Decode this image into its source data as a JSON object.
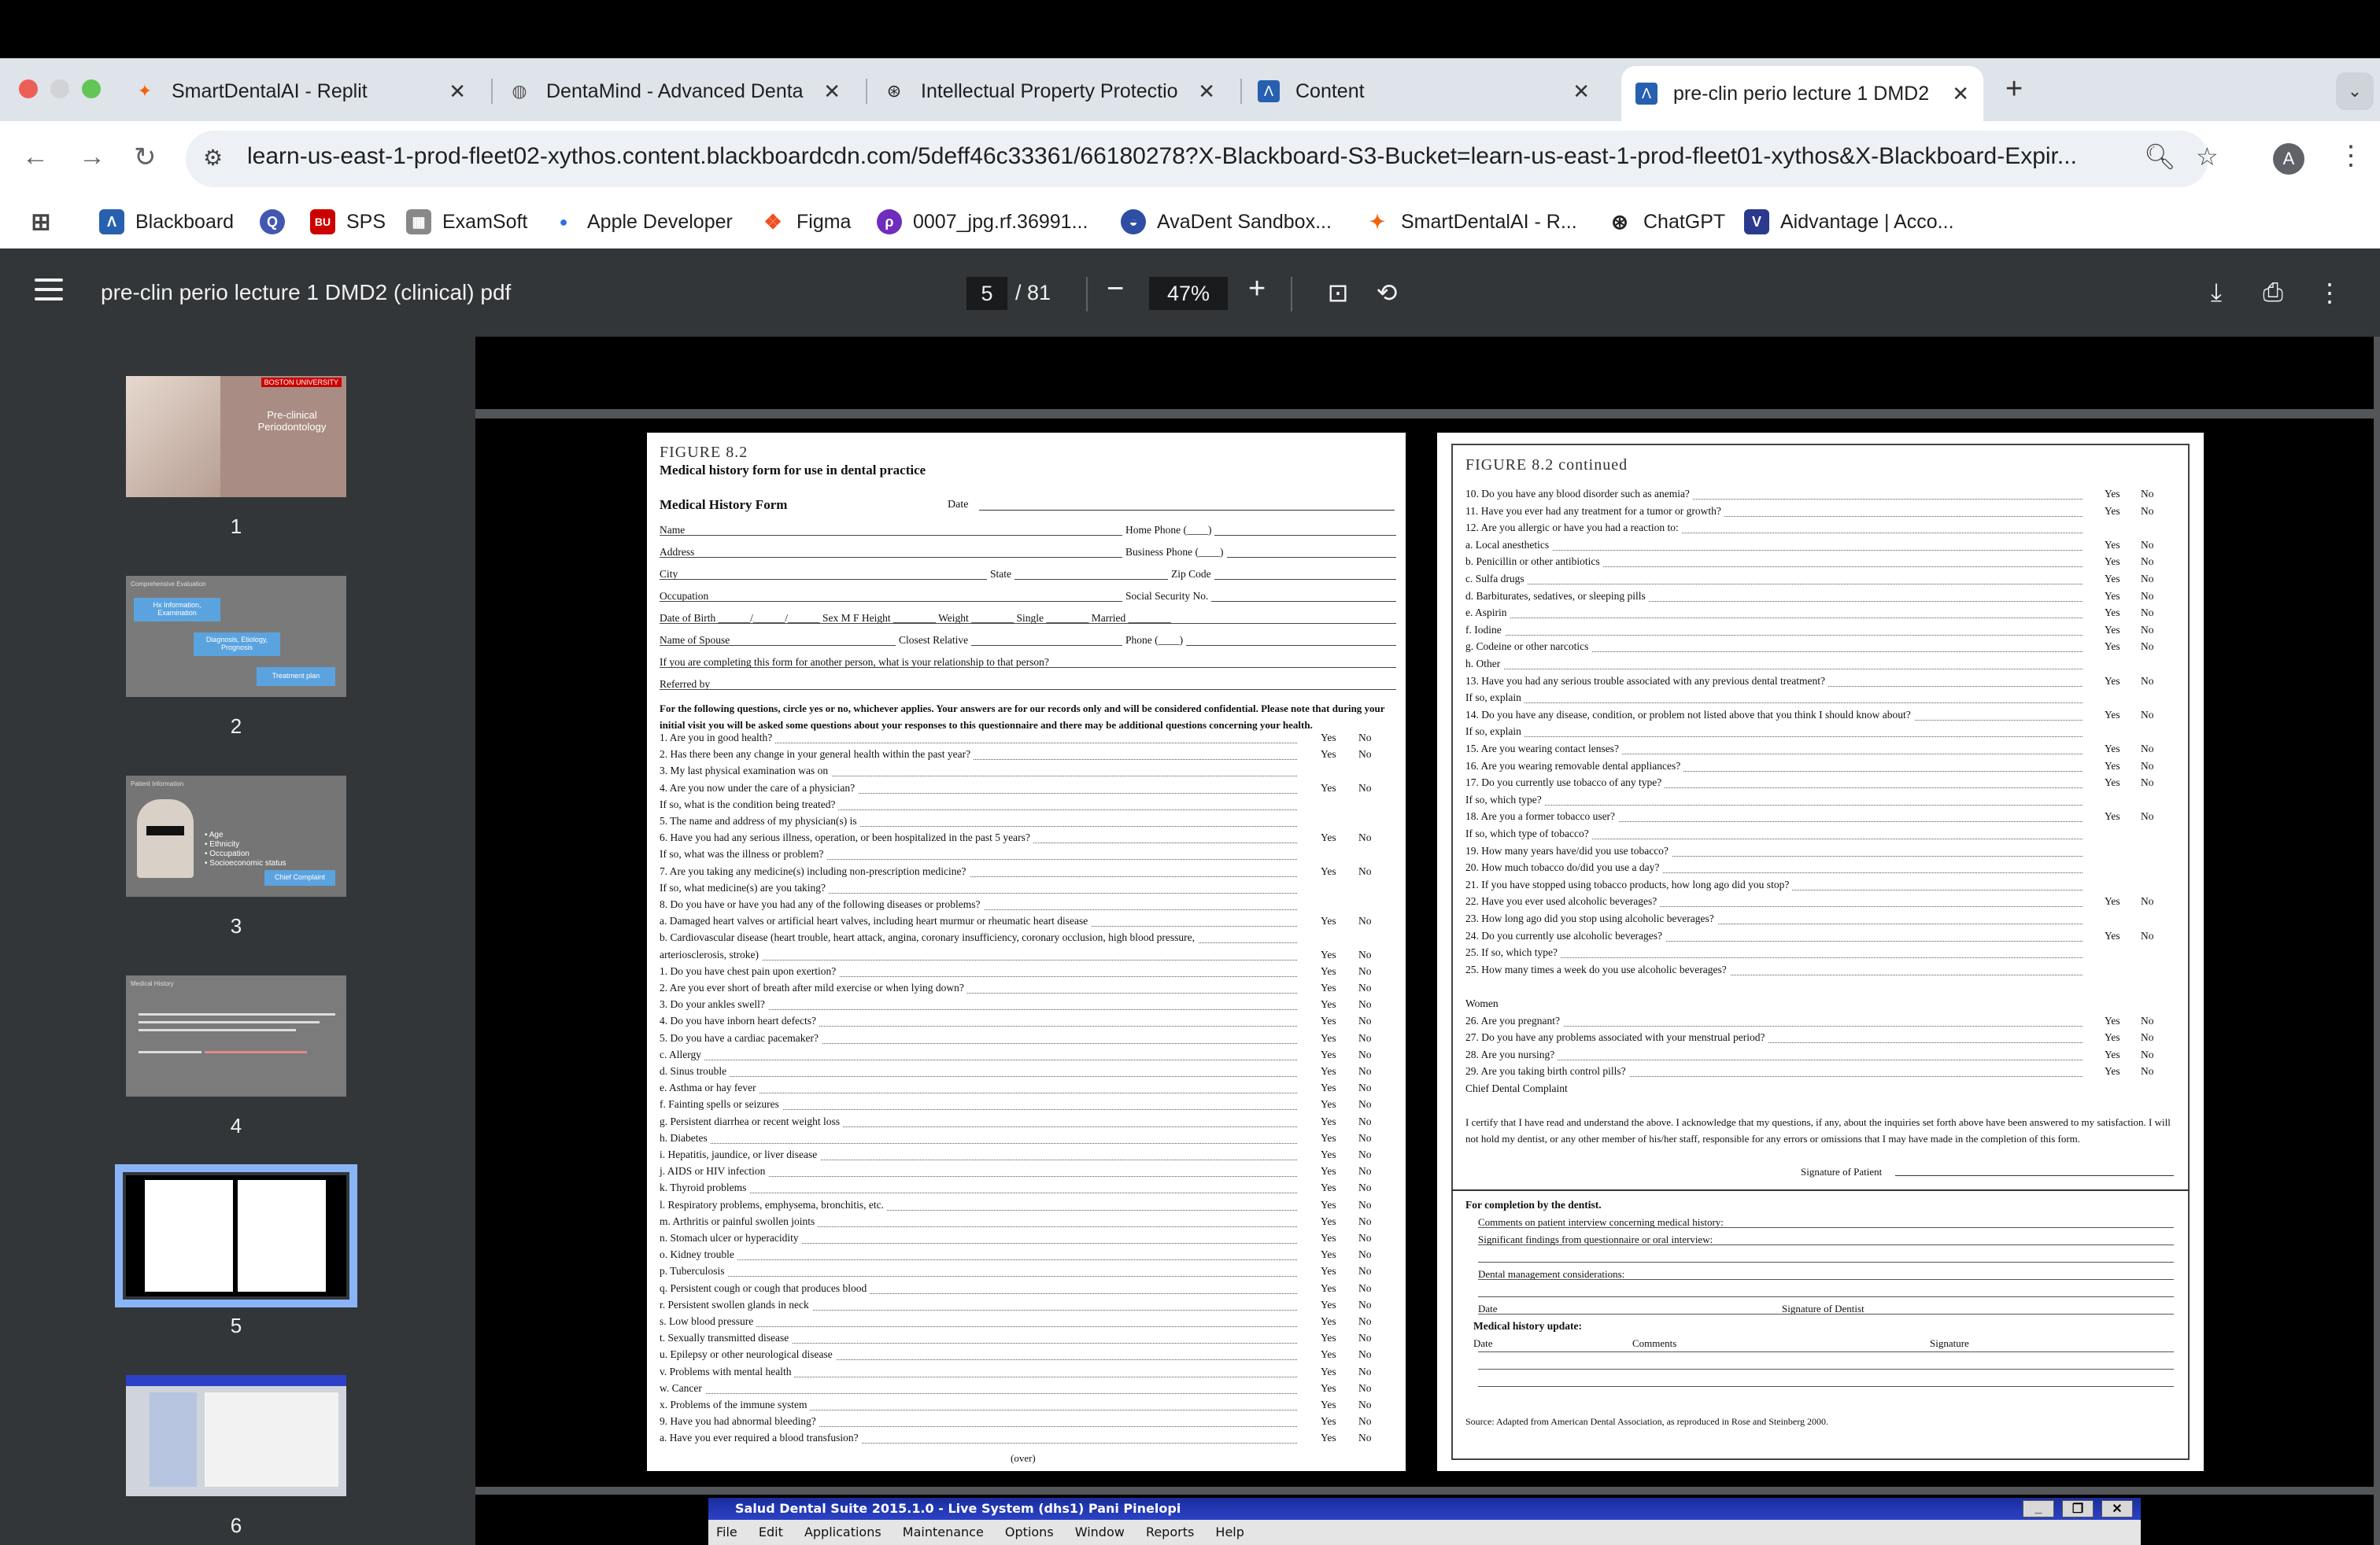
{
  "tabs": [
    {
      "label": "SmartDentalAI - Replit",
      "icon": "replit-icon"
    },
    {
      "label": "DentaMind - Advanced Denta",
      "icon": "globe-icon"
    },
    {
      "label": "Intellectual Property Protectio",
      "icon": "openai-icon"
    },
    {
      "label": "Content",
      "icon": "blackboard-icon"
    },
    {
      "label": "pre-clin perio lecture 1 DMD2",
      "icon": "blackboard-icon",
      "active": true
    }
  ],
  "address_bar": {
    "url": "learn-us-east-1-prod-fleet02-xythos.content.blackboardcdn.com/5deff46c33361/66180278?X-Blackboard-S3-Bucket=learn-us-east-1-prod-fleet01-xythos&X-Blackboard-Expir...",
    "profile_initial": "A"
  },
  "bookmarks": [
    {
      "label": "Blackboard"
    },
    {
      "label": ""
    },
    {
      "label": "SPS"
    },
    {
      "label": "ExamSoft"
    },
    {
      "label": "Apple Developer"
    },
    {
      "label": "Figma"
    },
    {
      "label": "0007_jpg.rf.36991..."
    },
    {
      "label": "AvaDent Sandbox..."
    },
    {
      "label": "SmartDentalAI - R..."
    },
    {
      "label": "ChatGPT"
    },
    {
      "label": "Aidvantage | Acco..."
    }
  ],
  "pdf_toolbar": {
    "title": "pre-clin perio lecture 1 DMD2 (clinical) pdf",
    "current_page": "5",
    "total_pages": "/ 81",
    "zoom": "47%",
    "zoom_out": "−",
    "zoom_in": "+"
  },
  "thumbnails": [
    {
      "num": "1",
      "title": "Pre-clinical Periodontology",
      "brand": "BOSTON UNIVERSITY"
    },
    {
      "num": "2",
      "title": "Comprehensive Evaluation",
      "boxes": [
        "Hx Information, Examination",
        "Diagnosis, Etiology, Prognosis",
        "Treatment plan"
      ]
    },
    {
      "num": "3",
      "title": "Patient Information",
      "bullets": [
        "Age",
        "Ethnicity",
        "Occupation",
        "Socioeconomic status"
      ],
      "badge": "Chief Complaint"
    },
    {
      "num": "4",
      "title": "Medical History"
    },
    {
      "num": "5"
    },
    {
      "num": "6"
    }
  ],
  "form_left": {
    "figure": "FIGURE 8.2",
    "caption": "Medical history form for use in dental practice",
    "heading": "Medical History Form",
    "date_label": "Date",
    "fields": [
      {
        "label": "Name",
        "right": "Home Phone (____)"
      },
      {
        "label": "Address",
        "right": "Business Phone (____)"
      },
      {
        "label": "City",
        "mid": "State",
        "right": "Zip Code"
      },
      {
        "label": "Occupation",
        "right": "Social Security No."
      },
      {
        "label": "Date of Birth ______/______/______  Sex  M  F   Height ________  Weight ________  Single ________  Married ________"
      },
      {
        "label": "Name of Spouse",
        "mid": "Closest Relative",
        "right": "Phone (____)"
      },
      {
        "label": "If you are completing this form for another person, what is your relationship to that person?"
      },
      {
        "label": "Referred by"
      }
    ],
    "instructions": "For the following questions, circle yes or no, whichever applies. Your answers are for our records only and will be considered confidential. Please note that during your initial visit you will be asked some questions about your responses to this questionnaire and there may be additional questions concerning your health.",
    "questions": [
      {
        "t": "1.  Are you in good health?",
        "yn": true
      },
      {
        "t": "2.  Has there been any change in your general health within the past year?",
        "yn": true
      },
      {
        "t": "3.  My last physical examination was on"
      },
      {
        "t": "4.  Are you now under the care of a physician?",
        "yn": true
      },
      {
        "t": "      If so, what is the condition being treated?"
      },
      {
        "t": "5.  The name and address of my physician(s) is"
      },
      {
        "t": "6.  Have you had any serious illness, operation, or been hospitalized in the past 5 years?",
        "yn": true
      },
      {
        "t": "      If so, what was the illness or problem?"
      },
      {
        "t": "7.  Are you taking any medicine(s) including non-prescription medicine?",
        "yn": true
      },
      {
        "t": "      If so, what medicine(s) are you taking?"
      },
      {
        "t": "8.  Do you have or have you had any of the following diseases or problems?"
      },
      {
        "t": "      a.  Damaged heart valves or artificial heart valves, including heart murmur or rheumatic heart disease",
        "yn": true
      },
      {
        "t": "      b.  Cardiovascular disease (heart trouble, heart attack, angina, coronary insufficiency, coronary occlusion, high blood pressure,"
      },
      {
        "t": "           arteriosclerosis, stroke)",
        "yn": true
      },
      {
        "t": "           1.  Do you have chest pain upon exertion?",
        "yn": true
      },
      {
        "t": "           2.  Are you ever short of breath after mild exercise or when lying down?",
        "yn": true
      },
      {
        "t": "           3.  Do your ankles swell?",
        "yn": true
      },
      {
        "t": "           4.  Do you have inborn heart defects?",
        "yn": true
      },
      {
        "t": "           5.  Do you have a cardiac pacemaker?",
        "yn": true
      },
      {
        "t": "      c.  Allergy",
        "yn": true
      },
      {
        "t": "      d.  Sinus trouble",
        "yn": true
      },
      {
        "t": "      e.  Asthma or hay fever",
        "yn": true
      },
      {
        "t": "      f.  Fainting spells or seizures",
        "yn": true
      },
      {
        "t": "      g.  Persistent diarrhea or recent weight loss",
        "yn": true
      },
      {
        "t": "      h.  Diabetes",
        "yn": true
      },
      {
        "t": "      i.  Hepatitis, jaundice, or liver disease",
        "yn": true
      },
      {
        "t": "      j.  AIDS or HIV infection",
        "yn": true
      },
      {
        "t": "      k.  Thyroid problems",
        "yn": true
      },
      {
        "t": "      l.  Respiratory problems, emphysema, bronchitis, etc.",
        "yn": true
      },
      {
        "t": "      m.  Arthritis or painful swollen joints",
        "yn": true
      },
      {
        "t": "      n.  Stomach ulcer or hyperacidity",
        "yn": true
      },
      {
        "t": "      o.  Kidney trouble",
        "yn": true
      },
      {
        "t": "      p.  Tuberculosis",
        "yn": true
      },
      {
        "t": "      q.  Persistent cough or cough that produces blood",
        "yn": true
      },
      {
        "t": "      r.  Persistent swollen glands in neck",
        "yn": true
      },
      {
        "t": "      s.  Low blood pressure",
        "yn": true
      },
      {
        "t": "      t.  Sexually transmitted disease",
        "yn": true
      },
      {
        "t": "      u.  Epilepsy or other neurological disease",
        "yn": true
      },
      {
        "t": "      v.  Problems with mental health",
        "yn": true
      },
      {
        "t": "      w.  Cancer",
        "yn": true
      },
      {
        "t": "      x.  Problems of the immune system",
        "yn": true
      },
      {
        "t": "9.  Have you had abnormal bleeding?",
        "yn": true
      },
      {
        "t": "      a.  Have you ever required a blood transfusion?",
        "yn": true
      }
    ],
    "over": "(over)",
    "yes": "Yes",
    "no": "No"
  },
  "form_right": {
    "figure": "FIGURE 8.2 continued",
    "questions": [
      {
        "t": "10.  Do you have any blood disorder such as anemia?",
        "yn": true
      },
      {
        "t": "11.  Have you ever had any treatment for a tumor or growth?",
        "yn": true
      },
      {
        "t": "12.  Are you allergic or have you had a reaction to:"
      },
      {
        "t": "        a.  Local anesthetics",
        "yn": true
      },
      {
        "t": "        b.  Penicillin or other antibiotics",
        "yn": true
      },
      {
        "t": "        c.  Sulfa drugs",
        "yn": true
      },
      {
        "t": "        d.  Barbiturates, sedatives, or sleeping pills",
        "yn": true
      },
      {
        "t": "        e.  Aspirin",
        "yn": true
      },
      {
        "t": "        f.  Iodine",
        "yn": true
      },
      {
        "t": "        g.  Codeine or other narcotics",
        "yn": true
      },
      {
        "t": "        h.  Other"
      },
      {
        "t": "13.  Have you had any serious trouble associated with any previous dental treatment?",
        "yn": true
      },
      {
        "t": "        If so, explain"
      },
      {
        "t": "14.  Do you have any disease, condition, or problem not listed above that you think I should know about?",
        "yn": true
      },
      {
        "t": "        If so, explain"
      },
      {
        "t": "15.  Are you wearing contact lenses?",
        "yn": true
      },
      {
        "t": "16.  Are you wearing removable dental appliances?",
        "yn": true
      },
      {
        "t": "17.  Do you currently use tobacco of any type?",
        "yn": true
      },
      {
        "t": "        If so, which type?"
      },
      {
        "t": "18.  Are you a former tobacco user?",
        "yn": true
      },
      {
        "t": "        If so, which type of tobacco?"
      },
      {
        "t": "19.  How many years have/did you use tobacco?"
      },
      {
        "t": "20.  How much tobacco do/did you use a day?"
      },
      {
        "t": "21.  If you have stopped using tobacco products, how long ago did you stop?"
      },
      {
        "t": "22.  Have you ever used alcoholic beverages?",
        "yn": true
      },
      {
        "t": "23.  How long ago did you stop using alcoholic beverages?"
      },
      {
        "t": "24.  Do you currently use alcoholic beverages?",
        "yn": true
      },
      {
        "t": "25.  If so, which type?"
      },
      {
        "t": "25.  How many times a week do you use alcoholic beverages?"
      },
      {
        "t": ""
      },
      {
        "t": "Women"
      },
      {
        "t": "26.  Are you pregnant?",
        "yn": true
      },
      {
        "t": "27.  Do you have any problems associated with your menstrual period?",
        "yn": true
      },
      {
        "t": "28.  Are you nursing?",
        "yn": true
      },
      {
        "t": "29.  Are you taking birth control pills?",
        "yn": true
      },
      {
        "t": "Chief Dental Complaint"
      }
    ],
    "certify": "I certify that I have read and understand the above. I acknowledge that my questions, if any, about the inquiries set forth above have been answered to my satisfaction. I will not hold my dentist, or any other member of his/her staff, responsible for any errors or omissions that I may have made in the completion of this form.",
    "signature_patient": "Signature of Patient",
    "dentist_heading": "For completion by the dentist.",
    "comments_label": "Comments on patient interview concerning medical history:",
    "findings_label": "Significant findings from questionnaire or oral interview:",
    "mgmt_label": "Dental management considerations:",
    "date_label": "Date",
    "signature_dentist": "Signature of Dentist",
    "update_heading": "Medical history update:",
    "update_cols": [
      "Date",
      "Comments",
      "Signature"
    ],
    "source": "Source:  Adapted from American Dental Association, as reproduced in Rose and Steinberg 2000.",
    "yes": "Yes",
    "no": "No"
  },
  "salud": {
    "title": "Salud Dental Suite 2015.1.0 - Live System (dhs1) Pani Pinelopi",
    "menu": [
      "File",
      "Edit",
      "Applications",
      "Maintenance",
      "Options",
      "Window",
      "Reports",
      "Help"
    ]
  }
}
